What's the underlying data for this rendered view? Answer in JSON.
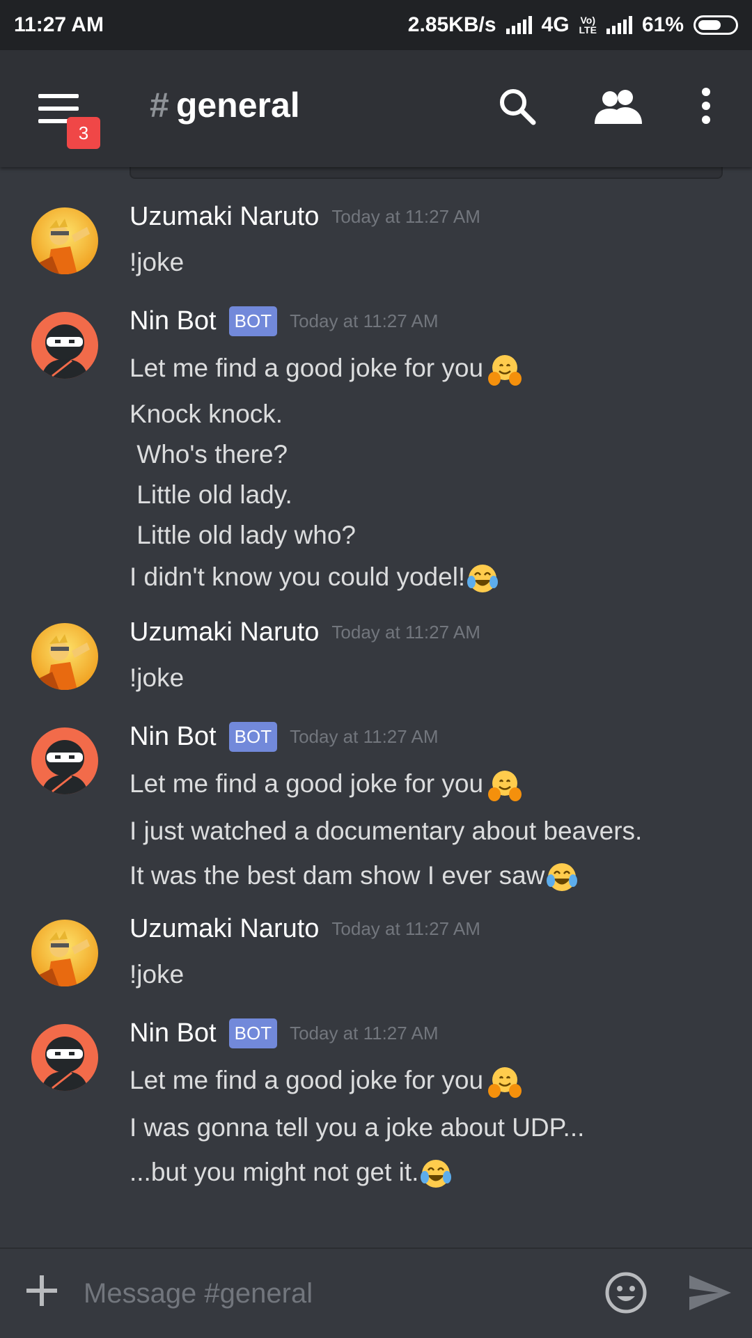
{
  "status_bar": {
    "time": "11:27 AM",
    "net_speed": "2.85KB/s",
    "network": "4G",
    "volte": "Vo)\nLTE",
    "battery": "61%"
  },
  "header": {
    "notification_count": "3",
    "channel_name": "general",
    "hash": "#"
  },
  "messages": [
    {
      "author": "Uzumaki Naruto",
      "bot": false,
      "timestamp": "Today at 11:27 AM",
      "lines": [
        "!joke"
      ]
    },
    {
      "author": "Nin Bot",
      "bot": true,
      "bot_tag": "BOT",
      "timestamp": "Today at 11:27 AM",
      "lines": [
        "Let me find a good joke for you",
        "Knock knock.",
        " Who's there?",
        " Little old lady.",
        " Little old lady who?",
        "I didn't know you could yodel!"
      ]
    },
    {
      "author": "Uzumaki Naruto",
      "bot": false,
      "timestamp": "Today at 11:27 AM",
      "lines": [
        "!joke"
      ]
    },
    {
      "author": "Nin Bot",
      "bot": true,
      "bot_tag": "BOT",
      "timestamp": "Today at 11:27 AM",
      "lines": [
        "Let me find a good joke for you",
        "I just watched a documentary about beavers.",
        "It was the best dam show I ever saw"
      ]
    },
    {
      "author": "Uzumaki Naruto",
      "bot": false,
      "timestamp": "Today at 11:27 AM",
      "lines": [
        "!joke"
      ]
    },
    {
      "author": "Nin Bot",
      "bot": true,
      "bot_tag": "BOT",
      "timestamp": "Today at 11:27 AM",
      "lines": [
        "Let me find a good joke for you",
        "I was gonna tell you a joke about UDP...",
        "...but you might not get it."
      ]
    }
  ],
  "input": {
    "placeholder": "Message #general"
  },
  "icons": {
    "menu": "hamburger-icon",
    "search": "search-icon",
    "members": "members-icon",
    "more": "more-vertical-icon",
    "add": "plus-icon",
    "emoji": "smiley-icon",
    "send": "send-icon",
    "hug": "hugging-face-emoji",
    "laugh": "tears-of-joy-emoji"
  },
  "colors": {
    "background": "#36393f",
    "header": "#2f3136",
    "bot_tag": "#7289da",
    "badge": "#f04747",
    "bot_avatar": "#f26b4a"
  }
}
